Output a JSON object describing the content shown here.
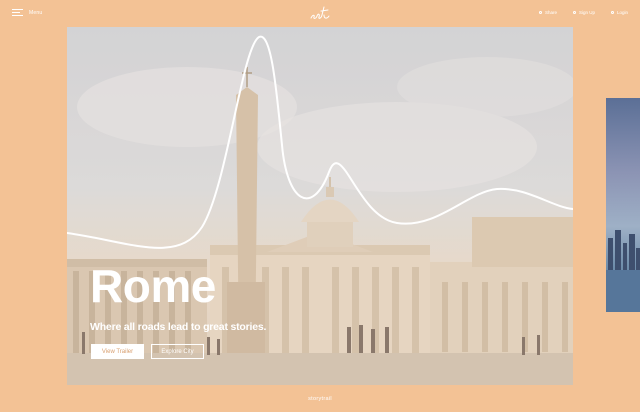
{
  "header": {
    "menu_label": "Menu",
    "nav": [
      {
        "label": "Share",
        "icon": "share-icon"
      },
      {
        "label": "Sign Up",
        "icon": "user-icon"
      },
      {
        "label": "Login",
        "icon": "login-icon"
      }
    ]
  },
  "hero": {
    "title": "Rome",
    "tagline": "Where all roads lead to great stories.",
    "primary_button": "View Trailer",
    "secondary_button": "Explore City"
  },
  "footer": {
    "brand": "storytrail"
  },
  "colors": {
    "background": "#f3c295",
    "button_text": "#d9a071",
    "white": "#ffffff"
  }
}
